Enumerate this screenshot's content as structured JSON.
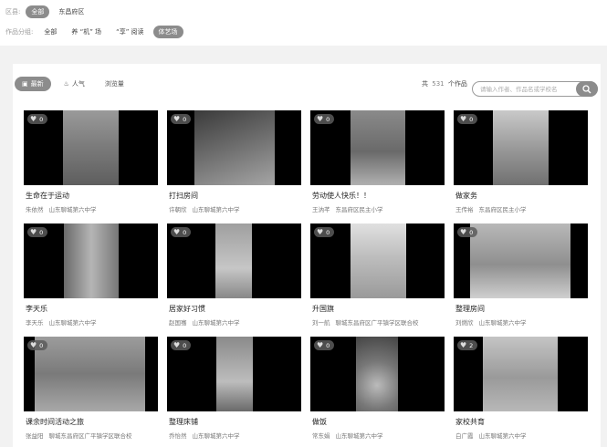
{
  "filters": {
    "region_label": "区县:",
    "regions": [
      {
        "label": "全部",
        "active": true
      },
      {
        "label": "东昌府区",
        "active": false
      }
    ],
    "group_label": "作品分组:",
    "groups": [
      {
        "label": "全部",
        "active": false
      },
      {
        "label": "养 “机” 场",
        "active": false
      },
      {
        "label": "“享” 阅读",
        "active": false
      },
      {
        "label": "体艺场",
        "active": true
      }
    ]
  },
  "sort": {
    "latest": "最新",
    "popular": "人气",
    "views": "浏览量"
  },
  "total": {
    "prefix": "共",
    "count": "531",
    "suffix": "个作品"
  },
  "search": {
    "placeholder": "请输入作者、作品名或学校名"
  },
  "works": [
    {
      "title": "生命在于运动",
      "author": "朱依然",
      "school": "山东聊城第六中学",
      "likes": "0"
    },
    {
      "title": "打扫房间",
      "author": "许朝欣",
      "school": "山东聊城第六中学",
      "likes": "0"
    },
    {
      "title": "劳动使人快乐！！",
      "author": "王汭芊",
      "school": "东昌府区民主小学",
      "likes": "0"
    },
    {
      "title": "做家务",
      "author": "王传裕",
      "school": "东昌府区民主小学",
      "likes": "0"
    },
    {
      "title": "李天乐",
      "author": "李天乐",
      "school": "山东聊城第六中学",
      "likes": "0"
    },
    {
      "title": "居家好习惯",
      "author": "赵国骞",
      "school": "山东聊城第六中学",
      "likes": "0"
    },
    {
      "title": "升国旗",
      "author": "刘一航",
      "school": "聊城东昌府区广平镇学区联合校",
      "likes": "0"
    },
    {
      "title": "整理房间",
      "author": "刘燃欣",
      "school": "山东聊城第六中学",
      "likes": "0"
    },
    {
      "title": "课余时间活动之旅",
      "author": "张益阳",
      "school": "聊城东昌府区广平镇学区联合校",
      "likes": "0"
    },
    {
      "title": "整理床铺",
      "author": "乔怡然",
      "school": "山东聊城第六中学",
      "likes": "0"
    },
    {
      "title": "做饭",
      "author": "常东娟",
      "school": "山东聊城第六中学",
      "likes": "0"
    },
    {
      "title": "家校共育",
      "author": "白广霞",
      "school": "山东聊城第六中学",
      "likes": "2"
    }
  ],
  "colors": {
    "page_bg": "#f2f2f2",
    "active_chip": "#8c8c8c",
    "thumb_bg": "#000000"
  }
}
